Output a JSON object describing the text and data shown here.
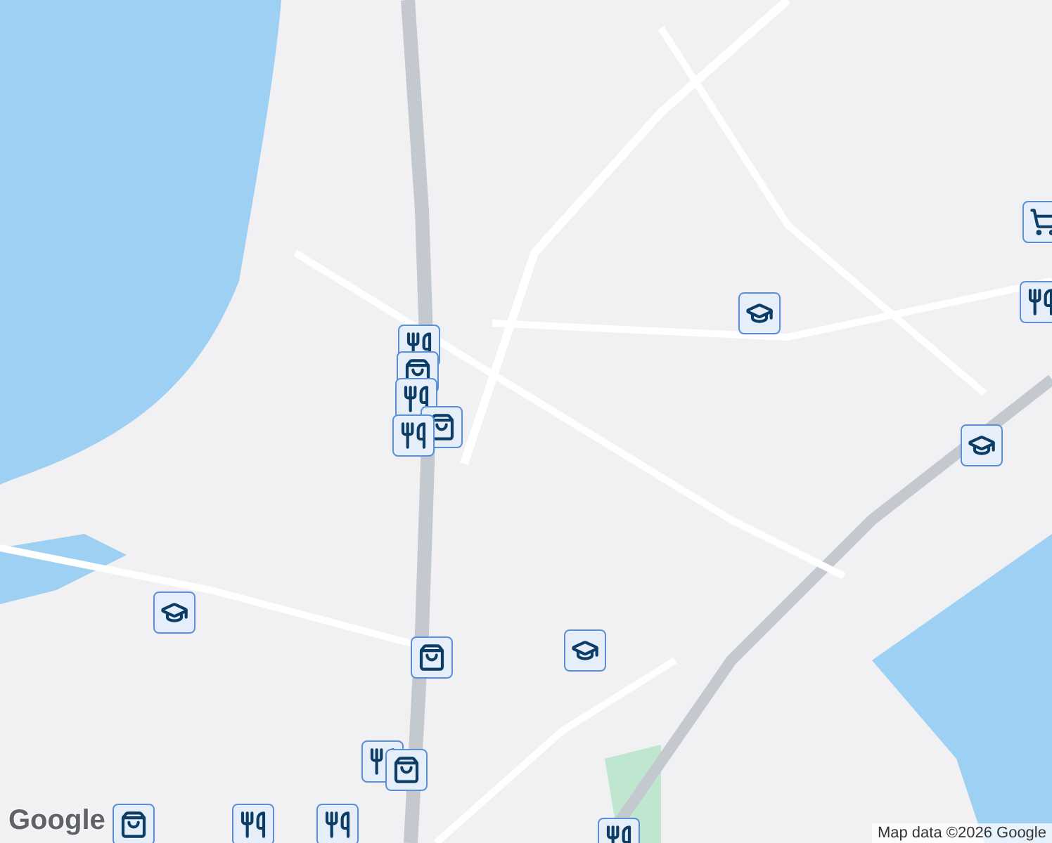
{
  "markers": [
    {
      "kind": "school"
    },
    {
      "kind": "school"
    },
    {
      "kind": "school"
    },
    {
      "kind": "school"
    },
    {
      "kind": "restaurant"
    },
    {
      "kind": "shopping"
    },
    {
      "kind": "restaurant"
    },
    {
      "kind": "shopping"
    },
    {
      "kind": "restaurant"
    },
    {
      "kind": "shopping"
    },
    {
      "kind": "cart"
    },
    {
      "kind": "restaurant"
    },
    {
      "kind": "restaurant"
    },
    {
      "kind": "shopping"
    },
    {
      "kind": "shopping"
    },
    {
      "kind": "restaurant"
    },
    {
      "kind": "restaurant"
    },
    {
      "kind": "restaurant"
    }
  ],
  "logo": "Google",
  "attribution": "Map data ©2026 Google"
}
